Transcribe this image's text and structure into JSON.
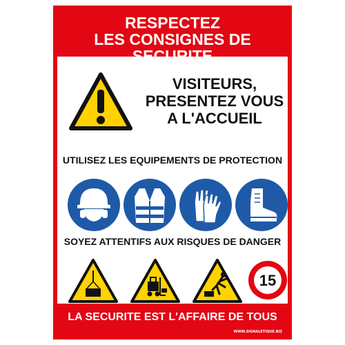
{
  "sign": {
    "header": {
      "line1": "RESPECTEZ",
      "line2": "LES CONSIGNES DE SECURITE"
    },
    "visitor_notice": {
      "line1": "VISITEURS,",
      "line2": "PRESENTEZ VOUS",
      "line3": "A L'ACCUEIL"
    },
    "ppe_heading": "UTILISEZ LES EQUIPEMENTS DE PROTECTION",
    "ppe_icons": [
      "helmet-icon",
      "safety-vest-icon",
      "gloves-icon",
      "safety-boots-icon"
    ],
    "danger_heading": "SOYEZ ATTENTIFS AUX RISQUES DE DANGER",
    "danger_icons": [
      "suspended-load-icon",
      "forklift-icon",
      "trip-hazard-icon"
    ],
    "speed_limit": "15",
    "footer": "LA SECURITE EST L'AFFAIRE DE TOUS",
    "credit": "WWW.SIGNALETIQUE.BIZ"
  },
  "colors": {
    "red": "#e30613",
    "mandatory_blue": "#1e5aa8",
    "warning_yellow": "#ffd200",
    "black": "#111111",
    "white": "#ffffff"
  }
}
